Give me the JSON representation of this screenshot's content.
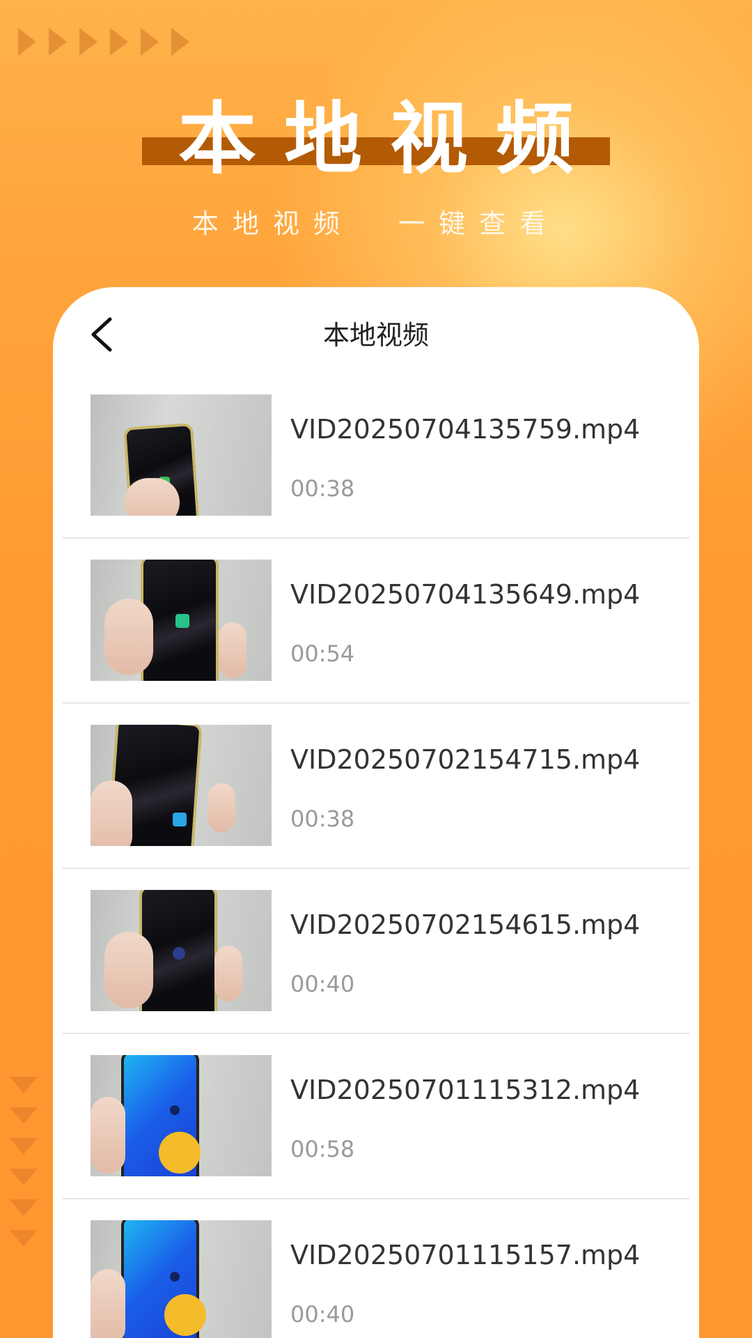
{
  "hero": {
    "title": "本地视频",
    "subtitle": "本地视频  一键查看"
  },
  "card": {
    "title": "本地视频",
    "back_icon": "chevron-left-icon"
  },
  "videos": [
    {
      "name": "VID20250704135759.mp4",
      "duration": "00:38"
    },
    {
      "name": "VID20250704135649.mp4",
      "duration": "00:54"
    },
    {
      "name": "VID20250702154715.mp4",
      "duration": "00:38"
    },
    {
      "name": "VID20250702154615.mp4",
      "duration": "00:40"
    },
    {
      "name": "VID20250701115312.mp4",
      "duration": "00:58"
    },
    {
      "name": "VID20250701115157.mp4",
      "duration": "00:40"
    }
  ],
  "colors": {
    "background": "#ff9a2e",
    "title_bar": "#b35a05",
    "card": "#ffffff"
  }
}
